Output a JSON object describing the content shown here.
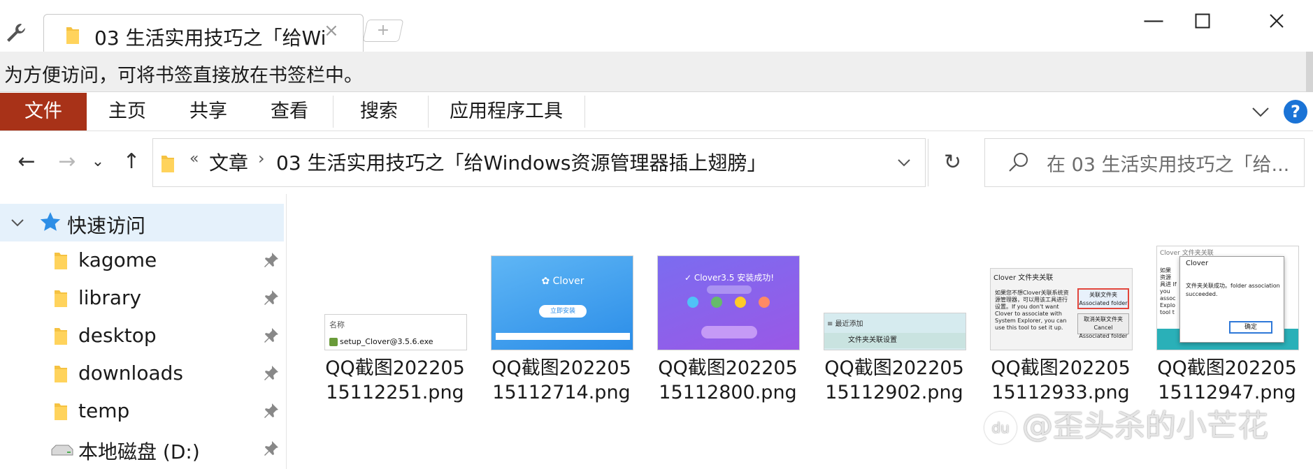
{
  "window": {
    "tab_title": "03 生活实用技巧之「给Wi",
    "tab_close_glyph": "×",
    "new_tab_glyph": "+",
    "minimize_glyph": "—",
    "maximize_glyph": "☐",
    "close_glyph": "✕"
  },
  "bookmark_bar": {
    "hint": "为方便访问，可将书签直接放在书签栏中。"
  },
  "ribbon": {
    "tabs": [
      "文件",
      "主页",
      "共享",
      "查看",
      "搜索",
      "应用程序工具"
    ],
    "help_glyph": "?",
    "accent_color": "#a83218"
  },
  "address": {
    "back_glyph": "←",
    "forward_glyph": "→",
    "recent_glyph": "⌄",
    "up_glyph": "↑",
    "overflow_glyph": "«",
    "crumbs": [
      "文章",
      "03 生活实用技巧之「给Windows资源管理器插上翅膀」"
    ],
    "crumb_sep": "›",
    "refresh_glyph": "↻",
    "search_placeholder": "在 03 生活实用技巧之「给..."
  },
  "nav_pane": {
    "quick_access_label": "快速访问",
    "items": [
      {
        "label": "kagome",
        "icon": "folder-icon"
      },
      {
        "label": "library",
        "icon": "folder-icon"
      },
      {
        "label": "desktop",
        "icon": "folder-icon"
      },
      {
        "label": "downloads",
        "icon": "folder-icon"
      },
      {
        "label": "temp",
        "icon": "folder-icon"
      },
      {
        "label": "本地磁盘 (D:)",
        "icon": "drive-icon"
      }
    ]
  },
  "files": [
    {
      "name": "QQ截图20220515112251.png",
      "thumb": {
        "header": "名称",
        "row": "setup_Clover@3.5.6.exe"
      }
    },
    {
      "name": "QQ截图20220515112714.png",
      "thumb": {
        "logo": "✿ Clover",
        "button": "立即安装"
      }
    },
    {
      "name": "QQ截图20220515112800.png",
      "thumb": {
        "title": "✓ Clover3.5 安装成功!"
      }
    },
    {
      "name": "QQ截图20220515112902.png",
      "thumb": {
        "bar": "≡  最近添加",
        "row": "文件夹关联设置"
      }
    },
    {
      "name": "QQ截图20220515112933.png",
      "thumb": {
        "header": "Clover 文件夹关联",
        "body": "如果您不想Clover关联系统资源管理器，可以用该工具进行设置。If you don't want Clover to associate with System Explorer, you can use this tool to set it up.",
        "btn1": "关联文件夹 Associated folder",
        "btn2": "取消关联文件夹 Cancel Associated folder"
      }
    },
    {
      "name": "QQ截图20220515112947.png",
      "thumb": {
        "top": "Clover 文件夹关联",
        "dialog_title": "Clover",
        "message": "文件夹关联成功。folder association succeeded.",
        "ok": "确定",
        "left": "如果 资源 具进 If you assoc Explo tool t"
      }
    }
  ],
  "watermark": {
    "badge": "du",
    "text": "@歪头杀的小芒花"
  }
}
